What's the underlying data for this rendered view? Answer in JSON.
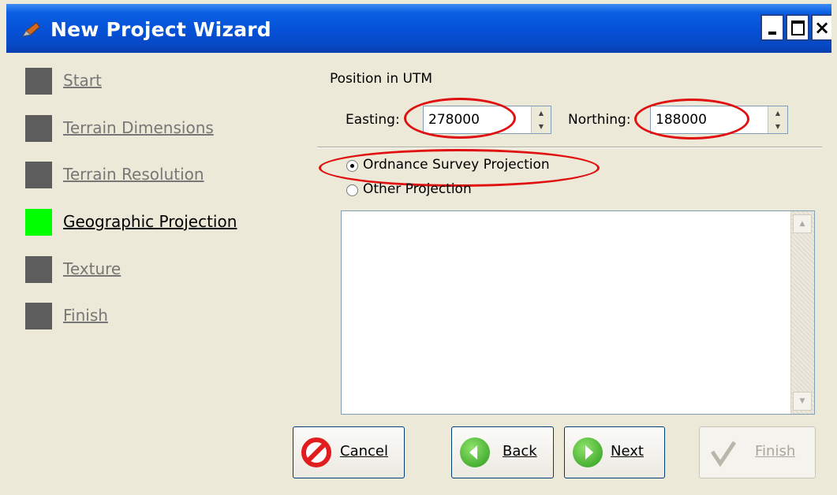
{
  "window": {
    "title": "New Project Wizard",
    "controls": {
      "minimize": "-",
      "maximize": "□",
      "close": "×"
    }
  },
  "steps": [
    {
      "label": "Start",
      "active": false
    },
    {
      "label": "Terrain Dimensions",
      "active": false
    },
    {
      "label": "Terrain Resolution",
      "active": false
    },
    {
      "label": "Geographic Projection",
      "active": true
    },
    {
      "label": "Texture",
      "active": false
    },
    {
      "label": "Finish",
      "active": false
    }
  ],
  "position": {
    "heading": "Position in UTM",
    "easting_label": "Easting:",
    "easting_value": "278000",
    "northing_label": "Northing:",
    "northing_value": "188000"
  },
  "projection": {
    "options": [
      {
        "label": "Ordnance Survey Projection",
        "selected": true
      },
      {
        "label": "Other Projection",
        "selected": false
      }
    ],
    "text": ""
  },
  "buttons": {
    "cancel": "Cancel",
    "back": "Back",
    "next": "Next",
    "finish": "Finish"
  },
  "colors": {
    "active_step": "#00ff00",
    "inactive_step": "#5d5d5d",
    "annotation": "#e01010",
    "titlebar": "#0551d6"
  }
}
